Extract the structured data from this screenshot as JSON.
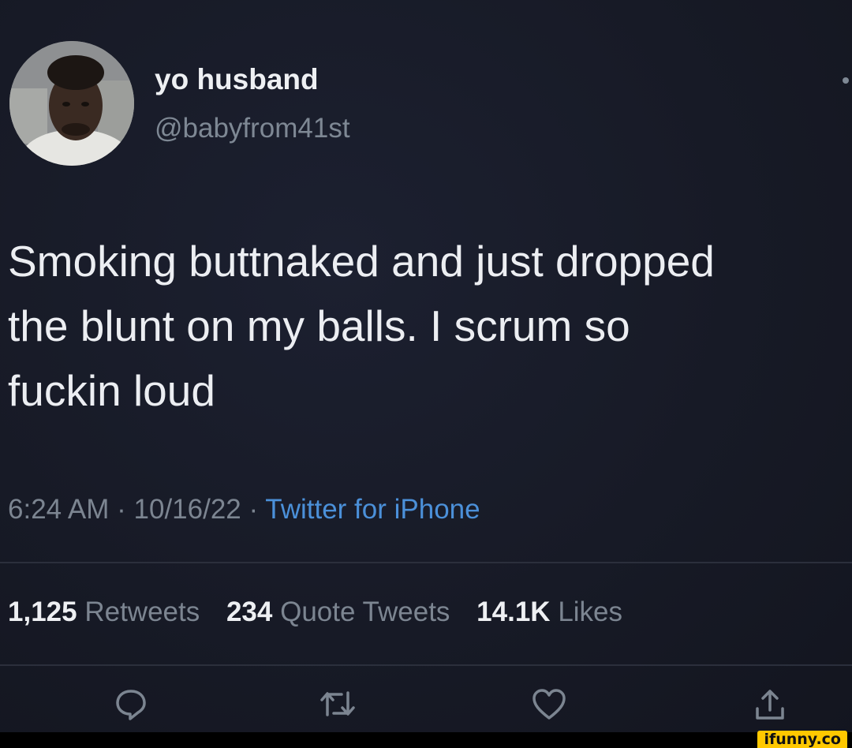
{
  "tweet": {
    "display_name": "yo husband",
    "handle": "@babyfrom41st",
    "text": "Smoking buttnaked and just dropped\nthe blunt on my balls. I scrum so\nfuckin loud",
    "time": "6:24 AM",
    "date": "10/16/22",
    "separator": " · ",
    "source": "Twitter for iPhone"
  },
  "stats": {
    "retweets_count": "1,125",
    "retweets_label": "Retweets",
    "quotes_count": "234",
    "quotes_label": "Quote Tweets",
    "likes_count": "14.1K",
    "likes_label": "Likes"
  },
  "actions": {
    "icons": [
      "reply-icon",
      "retweet-icon",
      "like-icon",
      "share-icon"
    ]
  },
  "watermark": {
    "text": "ifunny.co"
  },
  "colors": {
    "background": "#171a26",
    "text": "#eceef2",
    "muted": "#7c8591",
    "link": "#4b90d9",
    "watermark_bg": "#ffc800"
  }
}
